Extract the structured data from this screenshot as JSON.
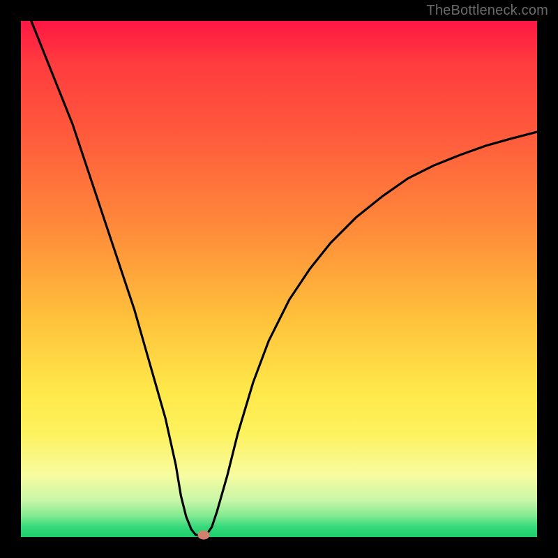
{
  "attribution": "TheBottleneck.com",
  "colors": {
    "frame": "#000000",
    "gradient_stops": [
      {
        "pos": 0.0,
        "color": "#ff1744"
      },
      {
        "pos": 0.08,
        "color": "#ff3b3f"
      },
      {
        "pos": 0.22,
        "color": "#ff5a3c"
      },
      {
        "pos": 0.4,
        "color": "#ff8a3a"
      },
      {
        "pos": 0.58,
        "color": "#ffc23c"
      },
      {
        "pos": 0.72,
        "color": "#ffe94a"
      },
      {
        "pos": 0.8,
        "color": "#fdf25e"
      },
      {
        "pos": 0.88,
        "color": "#f8fca0"
      },
      {
        "pos": 0.93,
        "color": "#c6f6a8"
      },
      {
        "pos": 0.96,
        "color": "#7fe991"
      },
      {
        "pos": 0.98,
        "color": "#36d97a"
      },
      {
        "pos": 1.0,
        "color": "#1bcf6a"
      }
    ],
    "curve_stroke": "#000000",
    "marker_fill": "#d4806f"
  },
  "chart_data": {
    "type": "line",
    "title": "",
    "xlabel": "",
    "ylabel": "",
    "xlim": [
      0,
      100
    ],
    "ylim": [
      0,
      100
    ],
    "grid": false,
    "series": [
      {
        "name": "left-branch",
        "x": [
          2,
          4,
          6,
          8,
          10,
          12,
          14,
          16,
          18,
          20,
          22,
          24,
          26,
          28,
          30,
          31,
          32,
          33,
          33.8
        ],
        "y": [
          100,
          95,
          90,
          85,
          80,
          74,
          68,
          62,
          56,
          50,
          44,
          37,
          30,
          23,
          14,
          8,
          4,
          1.5,
          0.5
        ]
      },
      {
        "name": "right-branch",
        "x": [
          36,
          37,
          38,
          40,
          42,
          45,
          48,
          52,
          56,
          60,
          65,
          70,
          75,
          80,
          85,
          90,
          95,
          100
        ],
        "y": [
          0.5,
          2,
          5,
          12,
          20,
          30,
          38,
          46,
          52,
          57,
          62,
          66,
          69.5,
          72,
          74,
          75.8,
          77.2,
          78.5
        ]
      },
      {
        "name": "valley-floor",
        "x": [
          33.8,
          34.4,
          35.0,
          35.6,
          36.0
        ],
        "y": [
          0.5,
          0.3,
          0.3,
          0.3,
          0.5
        ]
      }
    ],
    "annotations": [
      {
        "name": "optimal-point-marker",
        "x": 35.4,
        "y": 0.4
      }
    ],
    "legend": false
  }
}
